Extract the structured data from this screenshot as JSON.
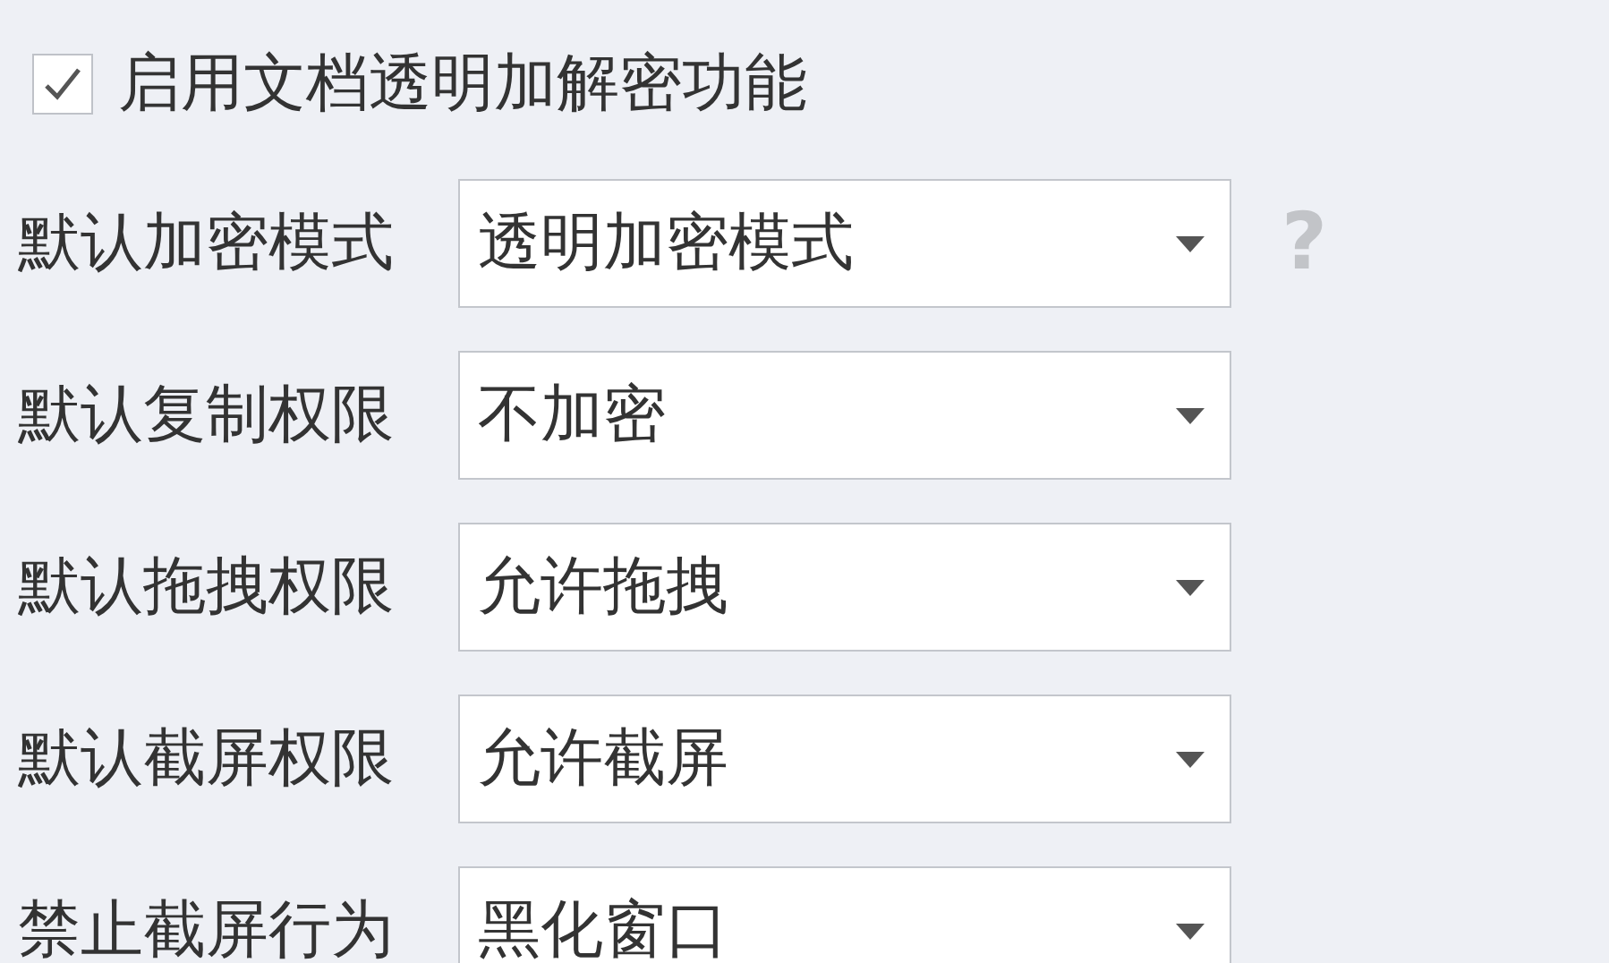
{
  "enable_option": {
    "label": "启用文档透明加解密功能",
    "checked": true
  },
  "settings": [
    {
      "label": "默认加密模式",
      "value": "透明加密模式",
      "help": "?"
    },
    {
      "label": "默认复制权限",
      "value": "不加密"
    },
    {
      "label": "默认拖拽权限",
      "value": "允许拖拽"
    },
    {
      "label": "默认截屏权限",
      "value": "允许截屏"
    },
    {
      "label": "禁止截屏行为",
      "value": "黑化窗口"
    }
  ]
}
